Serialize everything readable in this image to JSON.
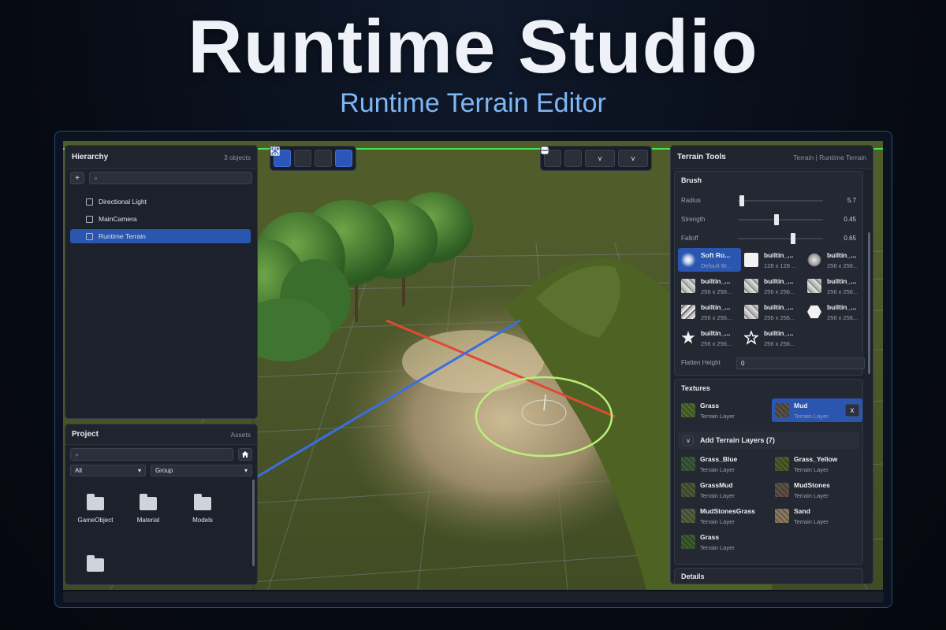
{
  "hero": {
    "title": "Runtime Studio",
    "subtitle": "Runtime Terrain Editor"
  },
  "colors": {
    "accent": "#2a56b0",
    "gizmo_ring": "#b9f07a",
    "axis_x": "#e04a35",
    "axis_z": "#3a6fe0",
    "grid_outline": "#43e35a"
  },
  "toolbar_left": {
    "buttons": [
      "move-icon",
      "rotate-icon",
      "scale-icon",
      "global-icon"
    ]
  },
  "toolbar_right": {
    "buttons": [
      "play-icon",
      "lock-icon",
      "camera-icon",
      "render-mode-icon"
    ],
    "dropdown_glyph": "v"
  },
  "hierarchy": {
    "title": "Hierarchy",
    "count": "3 objects",
    "add_label": "+",
    "items": [
      "Directional Light",
      "MainCamera",
      "Runtime Terrain"
    ],
    "selected_index": 2
  },
  "project": {
    "title": "Project",
    "meta": "Assets",
    "filter_value": "All",
    "group_value": "Group",
    "dropdown_glyph": "▾",
    "folders": [
      "GameObject",
      "Material",
      "Models",
      ""
    ]
  },
  "terrain_tools": {
    "title": "Terrain Tools",
    "meta": "Terrain | Runtime Terrain",
    "brush": {
      "title": "Brush",
      "radius_label": "Radius",
      "radius_value": "5.7",
      "radius_fraction": 0.05,
      "strength_label": "Strength",
      "strength_value": "0.45",
      "strength_fraction": 0.45,
      "falloff_label": "Falloff",
      "falloff_value": "0.65",
      "falloff_fraction": 0.65,
      "brushes": [
        {
          "name": "Soft Ro...",
          "size": "Default Br...",
          "kind": "soft"
        },
        {
          "name": "builtin_...",
          "size": "128 x 128 ...",
          "kind": "square"
        },
        {
          "name": "builtin_...",
          "size": "256 x 256...",
          "kind": "cloud"
        },
        {
          "name": "builtin_...",
          "size": "256 x 256...",
          "kind": "noise"
        },
        {
          "name": "builtin_...",
          "size": "256 x 256...",
          "kind": "noise"
        },
        {
          "name": "builtin_...",
          "size": "256 x 256...",
          "kind": "noise"
        },
        {
          "name": "builtin_...",
          "size": "256 x 256...",
          "kind": "noise2"
        },
        {
          "name": "builtin_...",
          "size": "256 x 256...",
          "kind": "noise"
        },
        {
          "name": "builtin_...",
          "size": "256 x 256...",
          "kind": "hex"
        },
        {
          "name": "builtin_...",
          "size": "256 x 256...",
          "kind": "star"
        },
        {
          "name": "builtin_...",
          "size": "256 x 256...",
          "kind": "star-outline"
        }
      ],
      "flatten_label": "Flatten Height",
      "flatten_value": "0"
    },
    "textures": {
      "title": "Textures",
      "active_layers": [
        {
          "name": "Grass",
          "type": "Terrain Layer",
          "color": "#4d6a2c"
        },
        {
          "name": "Mud",
          "type": "Terrain Layer",
          "color": "#5a5248"
        }
      ],
      "remove_label": "x",
      "add_toggle": "v",
      "add_label": "Add Terrain Layers (7)",
      "available_layers": [
        {
          "name": "Grass_Blue",
          "type": "Terrain Layer",
          "color": "#3a5a3a"
        },
        {
          "name": "Grass_Yellow",
          "type": "Terrain Layer",
          "color": "#4e5c2c"
        },
        {
          "name": "GrassMud",
          "type": "Terrain Layer",
          "color": "#4a5a38"
        },
        {
          "name": "MudStones",
          "type": "Terrain Layer",
          "color": "#5e5248"
        },
        {
          "name": "MudStonesGrass",
          "type": "Terrain Layer",
          "color": "#566040"
        },
        {
          "name": "Sand",
          "type": "Terrain Layer",
          "color": "#8a7a60"
        },
        {
          "name": "Grass",
          "type": "Terrain Layer",
          "color": "#3f5a30"
        }
      ]
    },
    "details": {
      "title": "Details"
    }
  }
}
